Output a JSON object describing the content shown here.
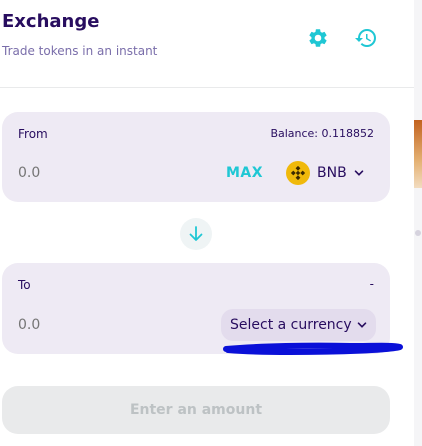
{
  "header": {
    "title": "Exchange",
    "subtitle": "Trade tokens in an instant",
    "settings_icon": "gear-icon",
    "history_icon": "history-icon"
  },
  "from_panel": {
    "label": "From",
    "balance": "Balance: 0.118852",
    "amount_value": "0.0",
    "max_label": "MAX",
    "token": "BNB",
    "token_icon": "bnb-logo-icon"
  },
  "switch": {
    "icon": "arrow-down-icon"
  },
  "to_panel": {
    "label": "To",
    "balance": "-",
    "amount_value": "0.0",
    "select_label": "Select a currency"
  },
  "submit": {
    "label": "Enter an amount"
  },
  "colors": {
    "primary_text": "#280d5f",
    "secondary_text": "#7a6eaa",
    "accent": "#1fc7d4",
    "panel_bg": "#eeeaf4",
    "bnb": "#f0b90b",
    "annotation": "#0a10d8"
  }
}
